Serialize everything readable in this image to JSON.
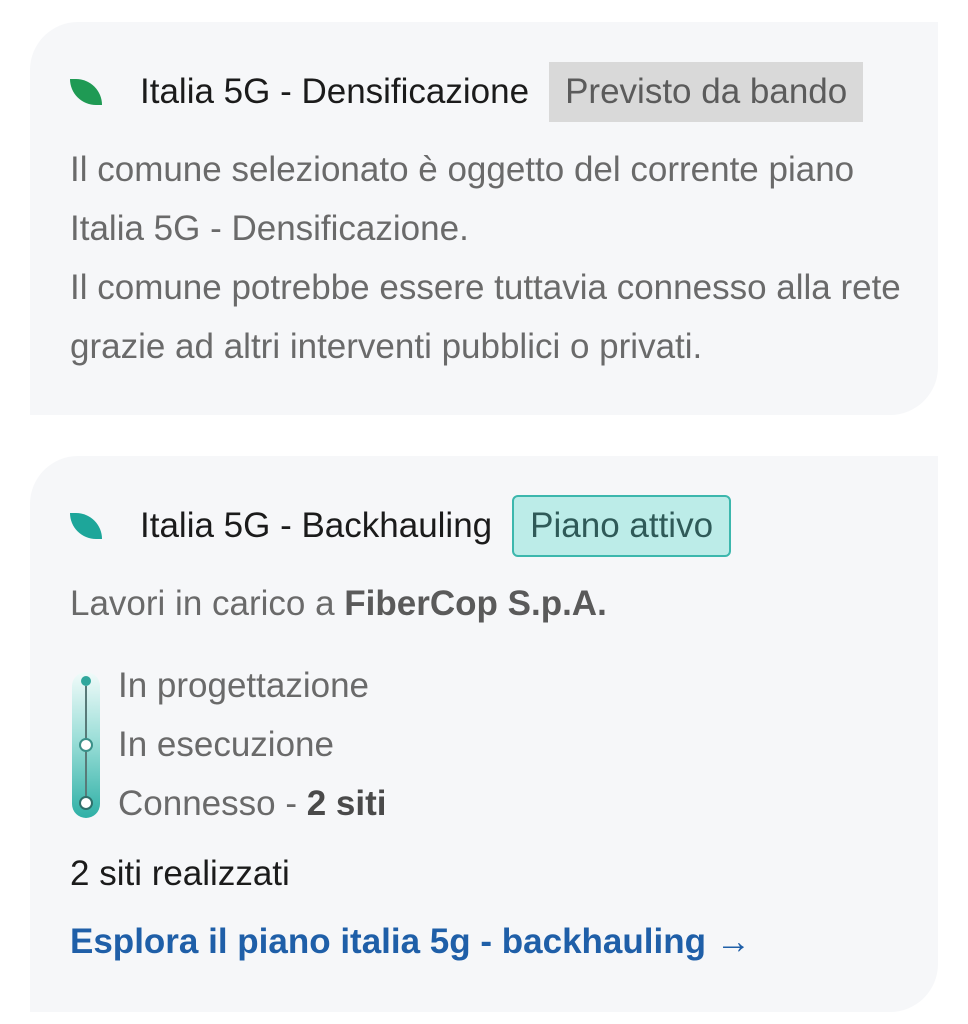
{
  "colors": {
    "leaf_densificazione": "#1f9a54",
    "leaf_backhauling": "#1da69a",
    "link": "#1f5fa8"
  },
  "card_densificazione": {
    "icon": "leaf-icon",
    "title": "Italia 5G - Densificazione",
    "badge": "Previsto da bando",
    "description_1": "Il comune selezionato è oggetto del corrente piano Italia 5G - Densificazione.",
    "description_2": "Il comune potrebbe essere tuttavia connesso alla rete grazie ad altri interventi pubblici o privati."
  },
  "card_backhauling": {
    "icon": "leaf-icon",
    "title": "Italia 5G - Backhauling",
    "badge": "Piano attivo",
    "works_prefix": "Lavori in carico a ",
    "company": "FiberCop S.p.A.",
    "steps": [
      {
        "label": "In progettazione"
      },
      {
        "label": "In esecuzione"
      },
      {
        "label": "Connesso - ",
        "bold": "2 siti"
      }
    ],
    "realized": "2 siti realizzati",
    "explore_label": "Esplora il piano italia 5g - backhauling",
    "explore_arrow": "→"
  }
}
